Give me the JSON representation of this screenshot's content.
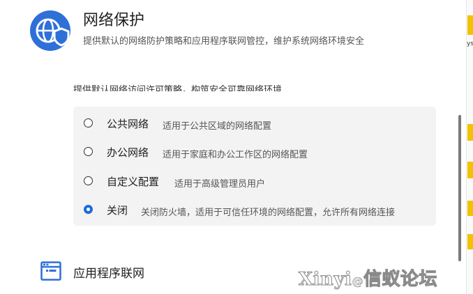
{
  "header": {
    "icon": "shield-globe-icon",
    "title": "网络保护",
    "description": "提供默认的网络防护策略和应用程序联网管控，维护系统网络环境安全"
  },
  "section_hint": "提供默认网络访问许可策略，构筑安全可靠网络环境",
  "options": [
    {
      "label": "公共网络",
      "description": "适用于公共区域的网络配置",
      "selected": false
    },
    {
      "label": "办公网络",
      "description": "适用于家庭和办公工作区的网络配置",
      "selected": false
    },
    {
      "label": "自定义配置",
      "description": "适用于高级管理员用户",
      "selected": false
    },
    {
      "label": "关闭",
      "description": "关闭防火墙，适用于可信任环境的网络配置，允许所有网络连接",
      "selected": true
    }
  ],
  "app_section": {
    "icon": "app-window-icon",
    "title": "应用程序联网"
  },
  "right_strip": {
    "text": "ys"
  },
  "watermark": {
    "text": "Xinyi",
    "at": "@",
    "suffix": "信蚁论坛"
  },
  "colors": {
    "accent": "#1a6fd6",
    "card_bg": "#f3f3f3",
    "strip_mark": "#f2c200"
  }
}
